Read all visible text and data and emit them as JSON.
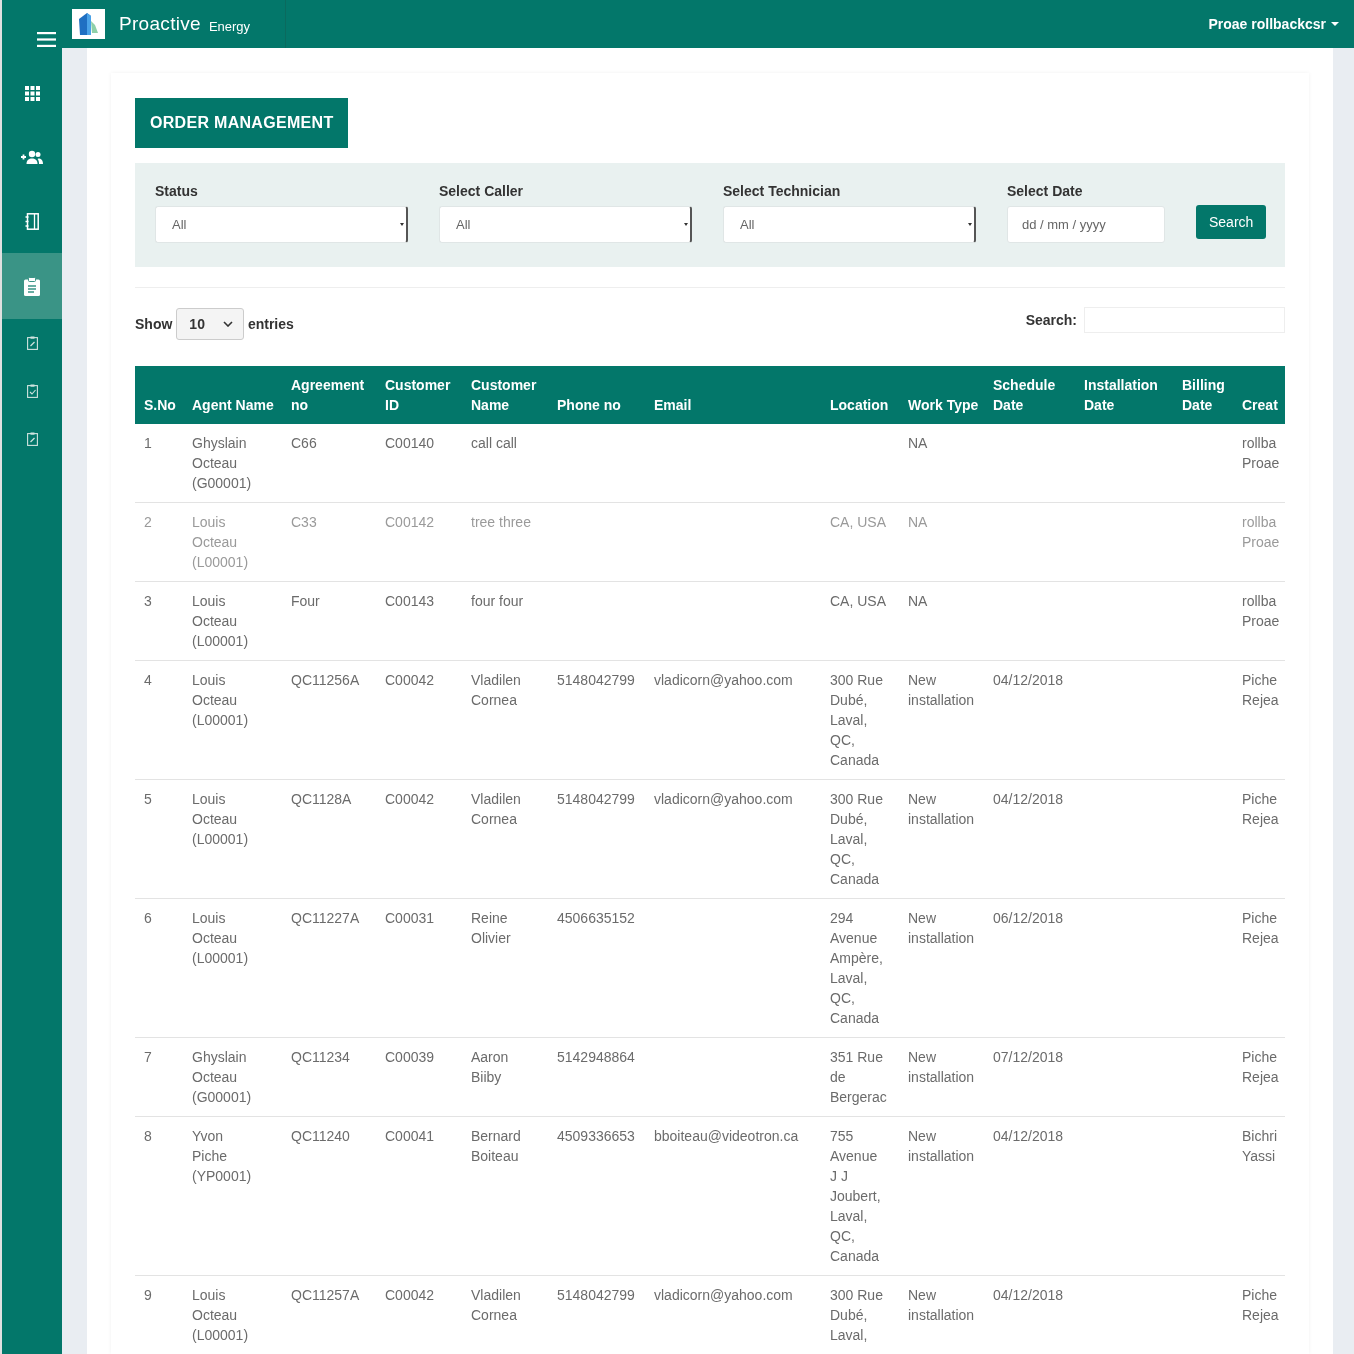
{
  "header": {
    "brand": "Proactive",
    "brand_suffix": "Energy",
    "user": "Proae rollbackcsr"
  },
  "sidebar": {
    "items": [
      {
        "kind": "grid",
        "selected": false
      },
      {
        "kind": "add-user",
        "selected": false
      },
      {
        "kind": "notebook",
        "selected": false
      },
      {
        "kind": "clipboard",
        "selected": true
      },
      {
        "kind": "clipboard-edit",
        "selected": false
      },
      {
        "kind": "clipboard-check",
        "selected": false
      },
      {
        "kind": "clipboard-edit",
        "selected": false
      }
    ]
  },
  "page_title": "ORDER MANAGEMENT",
  "filters": [
    {
      "kind": "select",
      "label": "Status",
      "value": "All"
    },
    {
      "kind": "select",
      "label": "Select Caller",
      "value": "All"
    },
    {
      "kind": "select",
      "label": "Select Technician",
      "value": "All"
    },
    {
      "kind": "date",
      "label": "Select Date",
      "placeholder": "dd / mm / yyyy"
    }
  ],
  "search_button": "Search",
  "length": {
    "before": "Show",
    "value": "10",
    "after": "entries"
  },
  "search": {
    "label": "Search:"
  },
  "table": {
    "columns": [
      "S.No",
      "Agent Name",
      "Agreement no",
      "Customer ID",
      "Customer Name",
      "Phone no",
      "Email",
      "Location",
      "Work Type",
      "Schedule Date",
      "Installation Date",
      "Billing Date",
      "Creat"
    ],
    "rows": [
      {
        "disabled": false,
        "cells": [
          "1",
          "Ghyslain Octeau (G00001)",
          "C66",
          "C00140",
          "call call",
          null,
          null,
          null,
          "NA",
          null,
          null,
          null,
          "rollba Proae"
        ]
      },
      {
        "disabled": true,
        "cells": [
          "2",
          "Louis Octeau (L00001)",
          "C33",
          "C00142",
          "tree three",
          null,
          null,
          "CA, USA",
          "NA",
          null,
          null,
          null,
          "rollba Proae"
        ]
      },
      {
        "disabled": false,
        "cells": [
          "3",
          "Louis Octeau (L00001)",
          "Four",
          "C00143",
          "four four",
          null,
          null,
          "CA, USA",
          "NA",
          null,
          null,
          null,
          "rollba Proae"
        ]
      },
      {
        "disabled": false,
        "cells": [
          "4",
          "Louis Octeau (L00001)",
          "QC11256A",
          "C00042",
          "Vladilen Cornea",
          "5148042799",
          "vladicorn@yahoo.com",
          "300 Rue Dubé, Laval, QC, Canada",
          "New installation",
          "04/12/2018",
          null,
          null,
          "Piche Rejea"
        ]
      },
      {
        "disabled": false,
        "cells": [
          "5",
          "Louis Octeau (L00001)",
          "QC1128A",
          "C00042",
          "Vladilen Cornea",
          "5148042799",
          "vladicorn@yahoo.com",
          "300 Rue Dubé, Laval, QC, Canada",
          "New installation",
          "04/12/2018",
          null,
          null,
          "Piche Rejea"
        ]
      },
      {
        "disabled": false,
        "cells": [
          "6",
          "Louis Octeau (L00001)",
          "QC11227A",
          "C00031",
          "Reine Olivier",
          "4506635152",
          null,
          "294 Avenue Ampère, Laval, QC, Canada",
          "New installation",
          "06/12/2018",
          null,
          null,
          "Piche Rejea"
        ]
      },
      {
        "disabled": false,
        "cells": [
          "7",
          "Ghyslain Octeau (G00001)",
          "QC11234",
          "C00039",
          "Aaron Biiby",
          "5142948864",
          null,
          "351 Rue de Bergerac",
          "New installation",
          "07/12/2018",
          null,
          null,
          "Piche Rejea"
        ]
      },
      {
        "disabled": false,
        "cells": [
          "8",
          "Yvon Piche (YP0001)",
          "QC11240",
          "C00041",
          "Bernard Boiteau",
          "4509336653",
          "bboiteau@videotron.ca",
          "755 Avenue J J Joubert, Laval, QC, Canada",
          "New installation",
          "04/12/2018",
          null,
          null,
          "Bichri Yassi"
        ]
      },
      {
        "disabled": false,
        "cells": [
          "9",
          "Louis Octeau (L00001)",
          "QC11257A",
          "C00042",
          "Vladilen Cornea",
          "5148042799",
          "vladicorn@yahoo.com",
          "300 Rue Dubé, Laval,",
          "New installation",
          "04/12/2018",
          null,
          null,
          "Piche Rejea"
        ]
      }
    ]
  }
}
